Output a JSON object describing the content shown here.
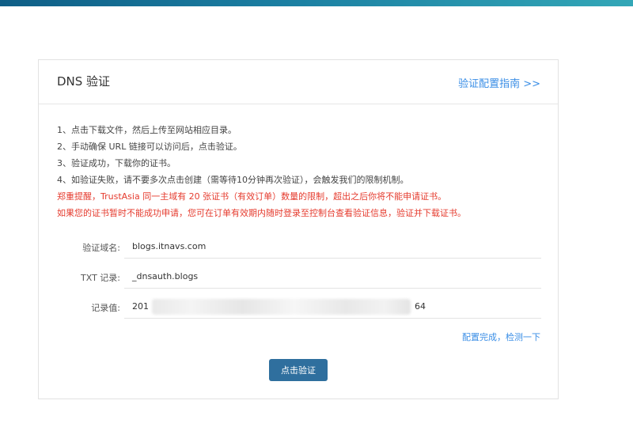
{
  "card": {
    "title": "DNS 验证",
    "guide_link": "验证配置指南 >>"
  },
  "instructions": {
    "steps": [
      "1、点击下载文件，然后上传至网站相应目录。",
      "2、手动确保 URL 链接可以访问后，点击验证。",
      "3、验证成功，下载你的证书。",
      "4、如验证失败，请不要多次点击创建（需等待10分钟再次验证），会触发我们的限制机制。"
    ],
    "warnings": [
      "郑重提醒，TrustAsia 同一主域有 20 张证书（有效订单）数量的限制，超出之后你将不能申请证书。",
      "如果您的证书暂时不能成功申请，您可在订单有效期内随时登录至控制台查看验证信息，验证并下载证书。"
    ]
  },
  "form": {
    "domain_label": "验证域名:",
    "domain_value": "blogs.itnavs.com",
    "txt_label": "TXT 记录:",
    "txt_value": "_dnsauth.blogs",
    "record_label": "记录值:",
    "record_value_prefix": "201",
    "record_value_suffix": "64"
  },
  "check_link": "配置完成，检测一下",
  "verify_button": "点击验证",
  "colors": {
    "accent_link": "#3a8ee6",
    "warning": "#e53b2e",
    "button": "#2f6f9e",
    "top_bar": "#1b7fa2"
  }
}
